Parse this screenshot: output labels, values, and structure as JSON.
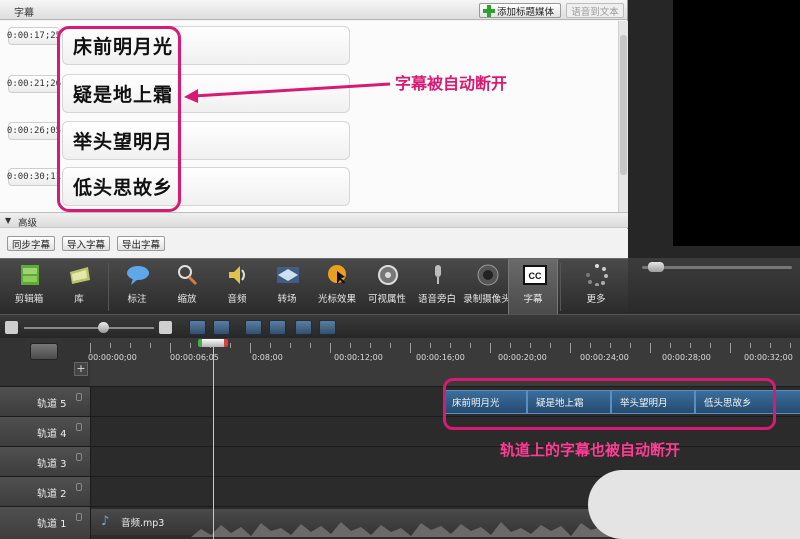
{
  "caption_panel": {
    "title": "字幕",
    "add_button": "添加标题媒体",
    "speech_to_text": "语音到文本",
    "captions": [
      {
        "time": "0:00:17;25",
        "text": "床前明月光"
      },
      {
        "time": "0:00:21;26",
        "text": "疑是地上霜"
      },
      {
        "time": "0:00:26;05",
        "text": "举头望明月"
      },
      {
        "time": "0:00:30;11",
        "text": "低头思故乡"
      }
    ],
    "advanced": "高级",
    "sync_button": "同步字幕",
    "import_button": "导入字幕",
    "export_button": "导出字幕"
  },
  "annotations": {
    "top": "字幕被自动断开",
    "bottom": "轨道上的字幕也被自动断开",
    "color": "#d81b72"
  },
  "tools": [
    {
      "label": "剪辑箱",
      "icon": "film-strip-icon"
    },
    {
      "label": "库",
      "icon": "library-icon"
    },
    {
      "label": "标注",
      "icon": "callout-icon"
    },
    {
      "label": "缩放",
      "icon": "zoom-magnifier-icon"
    },
    {
      "label": "音频",
      "icon": "speaker-icon"
    },
    {
      "label": "转场",
      "icon": "transition-icon"
    },
    {
      "label": "光标效果",
      "icon": "cursor-effect-icon"
    },
    {
      "label": "可视属性",
      "icon": "visual-properties-icon"
    },
    {
      "label": "语音旁白",
      "icon": "microphone-icon"
    },
    {
      "label": "录制摄像头",
      "icon": "webcam-icon"
    },
    {
      "label": "字幕",
      "icon": "cc-icon",
      "icon_text": "CC"
    },
    {
      "label": "更多",
      "icon": "more-dots-icon"
    }
  ],
  "timeline": {
    "playhead_time": "0:00:04;0",
    "ruler": [
      {
        "label": "00:00:00;00",
        "x": 0
      },
      {
        "label": "00:00:06;05",
        "x": 1
      },
      {
        "label": "0:08;00",
        "x": 2
      },
      {
        "label": "00:00:12;00",
        "x": 3
      },
      {
        "label": "00:00:16;00",
        "x": 4
      },
      {
        "label": "00:00:20;00",
        "x": 5
      },
      {
        "label": "00:00:24;00",
        "x": 6
      },
      {
        "label": "00:00:28;00",
        "x": 7
      },
      {
        "label": "00:00:32;00",
        "x": 8
      }
    ],
    "tracks": [
      {
        "name": "轨道 5"
      },
      {
        "name": "轨道 4"
      },
      {
        "name": "轨道 3"
      },
      {
        "name": "轨道 2"
      },
      {
        "name": "轨道 1"
      }
    ],
    "caption_clips": [
      "床前明月光",
      "疑是地上霜",
      "举头望明月",
      "低头思故乡"
    ],
    "audio_clip": "音频.mp3"
  }
}
